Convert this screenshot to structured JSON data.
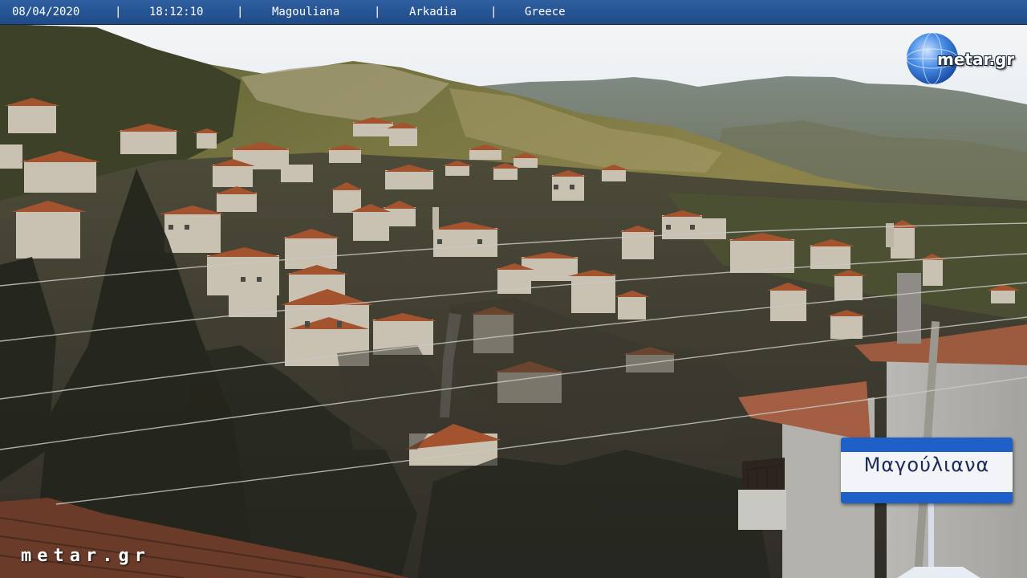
{
  "infobar": {
    "date": "08/04/2020",
    "time": "18:12:10",
    "place": "Magouliana",
    "region": "Arkadia",
    "country": "Greece",
    "separator": "|"
  },
  "logo": {
    "text": "metar.gr"
  },
  "watermark": {
    "text": "metar.gr"
  },
  "street_sign": {
    "text": "Μαγούλιανα"
  },
  "colors": {
    "infobar": "#2f5fa0",
    "sign_blue": "#1f5fc8",
    "roof_terracotta": "#a4532f",
    "sky": "#e9eef3"
  }
}
